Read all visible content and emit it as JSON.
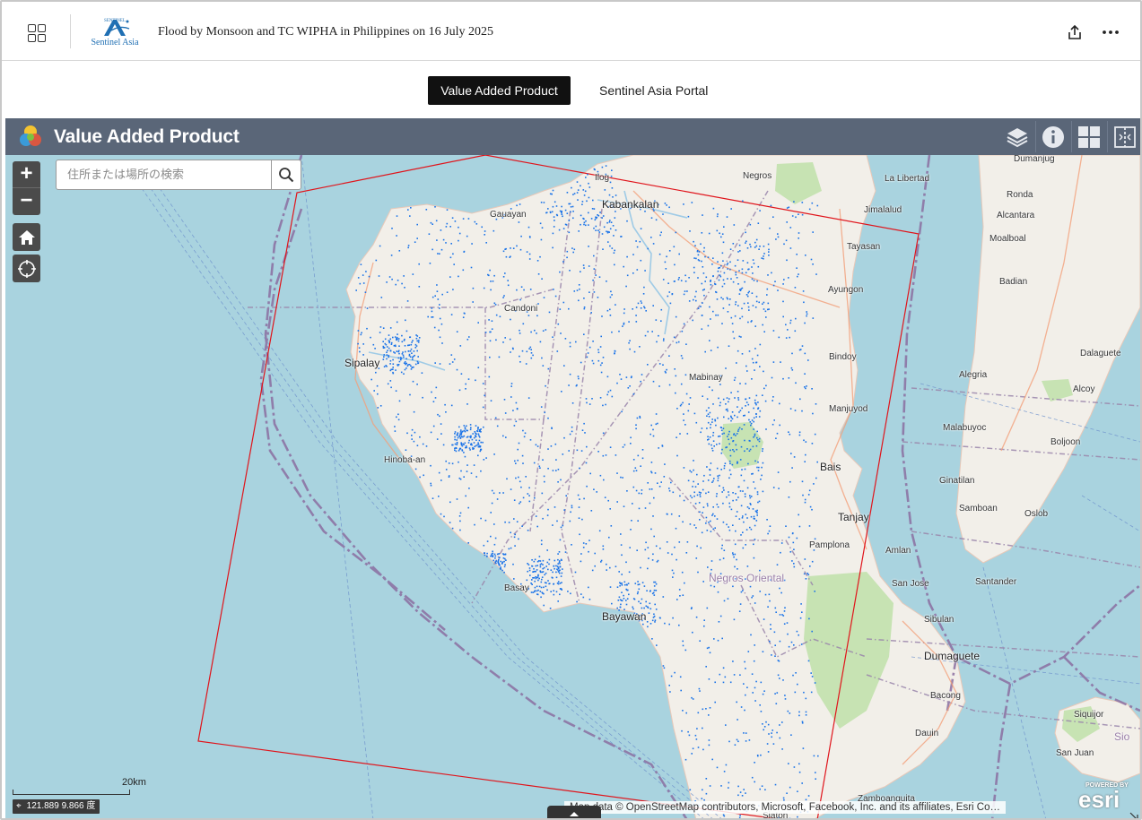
{
  "header": {
    "title": "Flood by Monsoon and TC WIPHA in Philippines on 16 July 2025",
    "logo_text": "Sentinel Asia"
  },
  "tabs": [
    {
      "label": "Value Added Product",
      "active": true
    },
    {
      "label": "Sentinel Asia Portal",
      "active": false
    }
  ],
  "app": {
    "title": "Value Added Product",
    "header_color": "#5a6678"
  },
  "search": {
    "placeholder": "住所または場所の検索"
  },
  "map": {
    "zoom_in": "+",
    "zoom_out": "−",
    "scale_label": "20km",
    "coordinates": "121.889 9.866 度",
    "attribution": "Map data © OpenStreetMap contributors, Microsoft, Facebook, Inc. and its affiliates, Esri Co…",
    "esri_powered": "POWERED BY",
    "esri_brand": "esri",
    "water_color": "#a9d3df",
    "land_color": "#f2efe9",
    "flood_color": "#1a73e8",
    "footprint_color": "#e0141b",
    "labels": {
      "ilog": "Ilog",
      "kabankalan": "Kabankalan",
      "gauayan": "Gauayan",
      "negros": "Negros",
      "la_libertad": "La Libertad",
      "jimalalud": "Jimalalud",
      "tayasan": "Tayasan",
      "ayungon": "Ayungon",
      "candoni": "Candoni",
      "sipalay": "Sipalay",
      "bindoy": "Bindoy",
      "mabinay": "Mabinay",
      "manjuyod": "Manjuyod",
      "hinoba_an": "Hinoba-an",
      "bais": "Bais",
      "tanjay": "Tanjay",
      "pamplona": "Pamplona",
      "amlan": "Amlan",
      "negros_oriental": "Negros Oriental",
      "basay": "Basay",
      "bayawan": "Bayawan",
      "san_jose": "San Jose",
      "sibulan": "Sibulan",
      "dumaguete": "Dumaguete",
      "bacong": "Bacong",
      "dauin": "Dauin",
      "zamboanguita": "Zamboanguita",
      "siaton": "Siaton",
      "dumanjug": "Dumanjug",
      "ronda": "Ronda",
      "alcantara": "Alcantara",
      "moalboal": "Moalboal",
      "badian": "Badian",
      "dalaguete": "Dalaguete",
      "alegria": "Alegria",
      "alcoy": "Alcoy",
      "malabuyoc": "Malabuyoc",
      "boljoon": "Boljoon",
      "ginatilan": "Ginatilan",
      "samboan": "Samboan",
      "oslob": "Oslob",
      "santander": "Santander",
      "siquijor": "Siquijor",
      "san_juan": "San Juan",
      "sio": "Sio"
    }
  }
}
